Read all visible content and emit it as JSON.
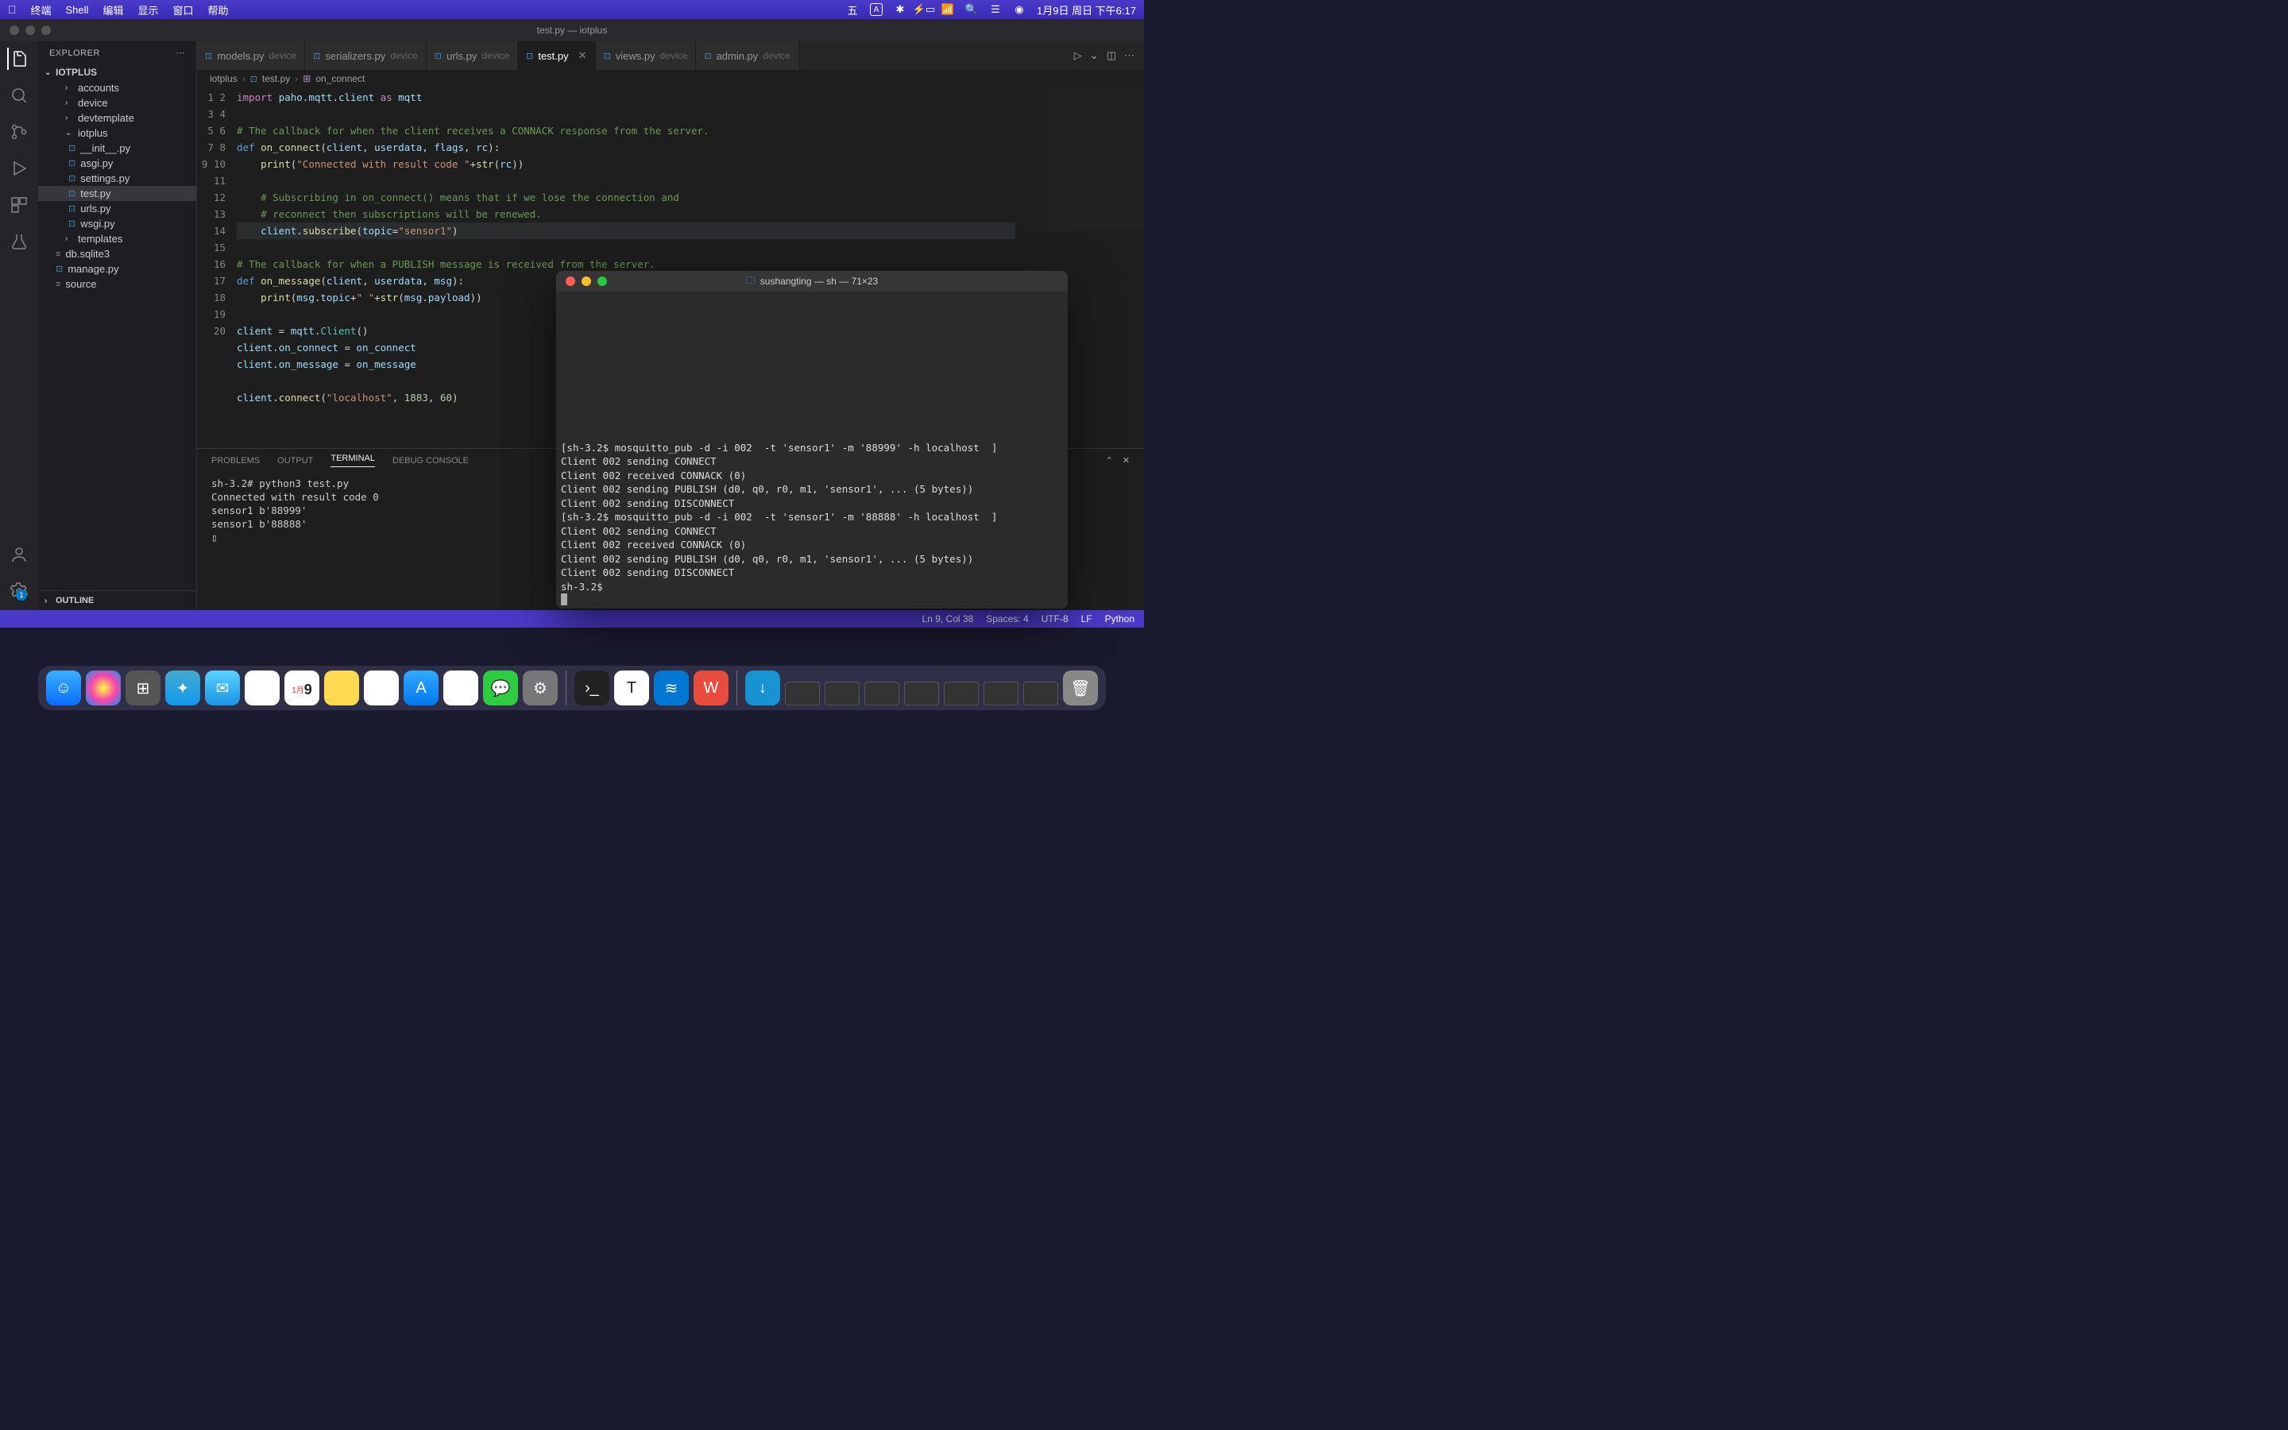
{
  "menubar": {
    "app": "终端",
    "menus": [
      "Shell",
      "编辑",
      "显示",
      "窗口",
      "帮助"
    ],
    "right_clock": "1月9日 周日 下午6:17"
  },
  "vscode": {
    "title": "test.py — iotplus",
    "explorer_label": "EXPLORER",
    "project_name": "IOTPLUS",
    "outline_label": "OUTLINE",
    "tree": {
      "folders_top": [
        "accounts",
        "device",
        "devtemplate"
      ],
      "iotplus_folder": "iotplus",
      "iotplus_files": [
        "__init__.py",
        "asgi.py",
        "settings.py",
        "test.py",
        "urls.py",
        "wsgi.py"
      ],
      "templates_folder": "templates",
      "root_files": [
        {
          "name": "db.sqlite3",
          "icon": "db"
        },
        {
          "name": "manage.py",
          "icon": "py"
        },
        {
          "name": "source",
          "icon": "file"
        }
      ]
    },
    "tabs": [
      {
        "icon": "py",
        "name": "models.py",
        "folder": "device"
      },
      {
        "icon": "py",
        "name": "serializers.py",
        "folder": "device"
      },
      {
        "icon": "py",
        "name": "urls.py",
        "folder": "device"
      },
      {
        "icon": "py",
        "name": "test.py",
        "folder": "",
        "active": true
      },
      {
        "icon": "py",
        "name": "views.py",
        "folder": "device"
      },
      {
        "icon": "py",
        "name": "admin.py",
        "folder": "device"
      }
    ],
    "breadcrumb": [
      "iotplus",
      "test.py",
      "on_connect"
    ],
    "code_lines": [
      {
        "n": 1,
        "html": "<span class='kw'>import</span> <span class='param'>paho</span>.<span class='param'>mqtt</span>.<span class='param'>client</span> <span class='kw'>as</span> <span class='param'>mqtt</span>"
      },
      {
        "n": 2,
        "html": ""
      },
      {
        "n": 3,
        "html": "<span class='cmt'># The callback for when the client receives a CONNACK response from the server.</span>"
      },
      {
        "n": 4,
        "html": "<span class='def'>def</span> <span class='fn'>on_connect</span>(<span class='param'>client</span>, <span class='param'>userdata</span>, <span class='param'>flags</span>, <span class='param'>rc</span>):"
      },
      {
        "n": 5,
        "html": "    <span class='fn'>print</span>(<span class='str'>\"Connected with result code \"</span>+<span class='fn'>str</span>(<span class='param'>rc</span>))"
      },
      {
        "n": 6,
        "html": ""
      },
      {
        "n": 7,
        "html": "    <span class='cmt'># Subscribing in on_connect() means that if we lose the connection and</span>"
      },
      {
        "n": 8,
        "html": "    <span class='cmt'># reconnect then subscriptions will be renewed.</span>"
      },
      {
        "n": 9,
        "html": "    <span class='param'>client</span>.<span class='fn'>subscribe</span>(<span class='param'>topic</span>=<span class='str'>\"sensor1\"</span>)",
        "hl": true
      },
      {
        "n": 10,
        "html": ""
      },
      {
        "n": 11,
        "html": "<span class='cmt'># The callback for when a PUBLISH message is received from the server.</span>"
      },
      {
        "n": 12,
        "html": "<span class='def'>def</span> <span class='fn'>on_message</span>(<span class='param'>client</span>, <span class='param'>userdata</span>, <span class='param'>msg</span>):"
      },
      {
        "n": 13,
        "html": "    <span class='fn'>print</span>(<span class='param'>msg</span>.<span class='param'>topic</span>+<span class='str'>\" \"</span>+<span class='fn'>str</span>(<span class='param'>msg</span>.<span class='param'>payload</span>))"
      },
      {
        "n": 14,
        "html": ""
      },
      {
        "n": 15,
        "html": "<span class='param'>client</span> = <span class='param'>mqtt</span>.<span class='cls'>Client</span>()"
      },
      {
        "n": 16,
        "html": "<span class='param'>client</span>.<span class='param'>on_connect</span> = <span class='param'>on_connect</span>"
      },
      {
        "n": 17,
        "html": "<span class='param'>client</span>.<span class='param'>on_message</span> = <span class='param'>on_message</span>"
      },
      {
        "n": 18,
        "html": ""
      },
      {
        "n": 19,
        "html": "<span class='param'>client</span>.<span class='fn'>connect</span>(<span class='str'>\"localhost\"</span>, <span class='num'>1883</span>, <span class='num'>60</span>)"
      },
      {
        "n": 20,
        "html": ""
      }
    ],
    "panel": {
      "tabs": [
        "PROBLEMS",
        "OUTPUT",
        "TERMINAL",
        "DEBUG CONSOLE"
      ],
      "active": "TERMINAL",
      "content": "sh-3.2# python3 test.py\nConnected with result code 0\nsensor1 b'88999'\nsensor1 b'88888'\n▯"
    },
    "status": {
      "pos": "Ln 9, Col 38",
      "spaces": "Spaces: 4",
      "enc": "UTF-8",
      "eol": "LF",
      "lang": "Python"
    }
  },
  "terminal_window": {
    "title": "sushangting — sh — 71×23",
    "lines": [
      "[sh-3.2$ mosquitto_pub -d -i 002  -t 'sensor1' -m '88999' -h localhost  ]",
      "Client 002 sending CONNECT",
      "Client 002 received CONNACK (0)",
      "Client 002 sending PUBLISH (d0, q0, r0, m1, 'sensor1', ... (5 bytes))",
      "Client 002 sending DISCONNECT",
      "[sh-3.2$ mosquitto_pub -d -i 002  -t 'sensor1' -m '88888' -h localhost  ]",
      "Client 002 sending CONNECT",
      "Client 002 received CONNACK (0)",
      "Client 002 sending PUBLISH (d0, q0, r0, m1, 'sensor1', ... (5 bytes))",
      "Client 002 sending DISCONNECT",
      "sh-3.2$ "
    ]
  },
  "dock_calendar": {
    "month": "1月",
    "day": "9"
  }
}
